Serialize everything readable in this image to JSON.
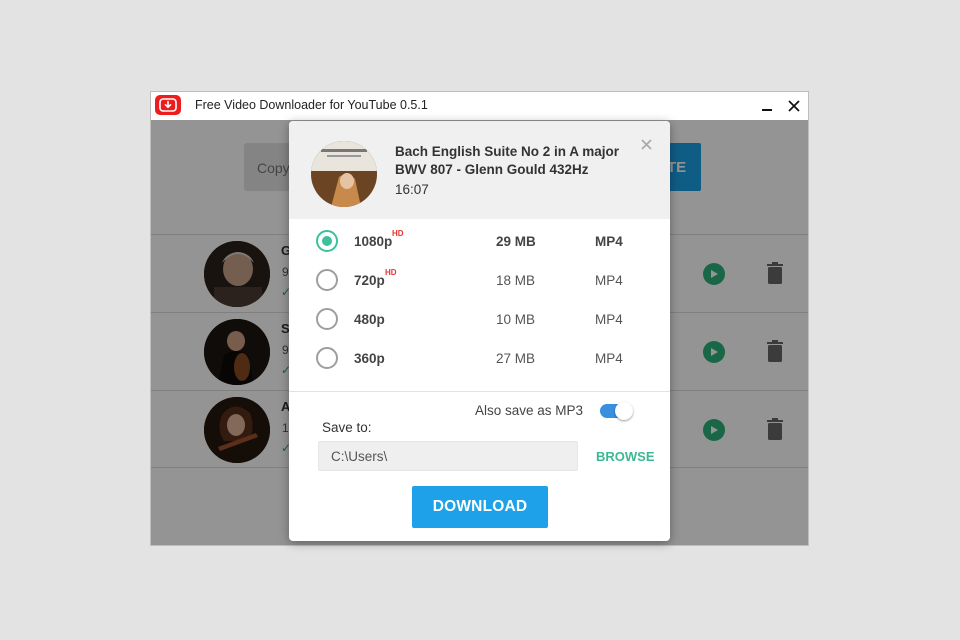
{
  "window": {
    "title": "Free Video Downloader for YouTube 0.5.1",
    "minimize_icon": "minimize-icon",
    "close_icon": "close-icon"
  },
  "main": {
    "paste_placeholder": "Copy",
    "paste_button_partial": "TE",
    "items": [
      {
        "title_initial": "G",
        "sub_initial": "9",
        "check": "✓"
      },
      {
        "title_initial": "S",
        "sub_initial": "9",
        "check": "✓"
      },
      {
        "title_initial": "A",
        "sub_initial": "1",
        "check": "✓"
      }
    ]
  },
  "dialog": {
    "title": "Bach English Suite No 2 in A major BWV 807 - Glenn Gould 432Hz",
    "duration": "16:07",
    "close_icon": "close-icon",
    "formats": [
      {
        "label": "1080p",
        "badge": "HD",
        "size": "29 MB",
        "type": "MP4",
        "selected": true
      },
      {
        "label": "720p",
        "badge": "HD",
        "size": "18 MB",
        "type": "MP4",
        "selected": false
      },
      {
        "label": "480p",
        "badge": "",
        "size": "10 MB",
        "type": "MP4",
        "selected": false
      },
      {
        "label": "360p",
        "badge": "",
        "size": "27 MB",
        "type": "MP4",
        "selected": false
      }
    ],
    "mp3_label": "Also save as MP3",
    "mp3_enabled": true,
    "save_to_label": "Save to:",
    "save_path": "C:\\Users\\",
    "browse_label": "BROWSE",
    "download_label": "DOWNLOAD"
  },
  "colors": {
    "accent_blue": "#1ea1e8",
    "accent_green": "#3cc29a",
    "hd_red": "#e63333",
    "logo_red": "#ee1d1d"
  }
}
